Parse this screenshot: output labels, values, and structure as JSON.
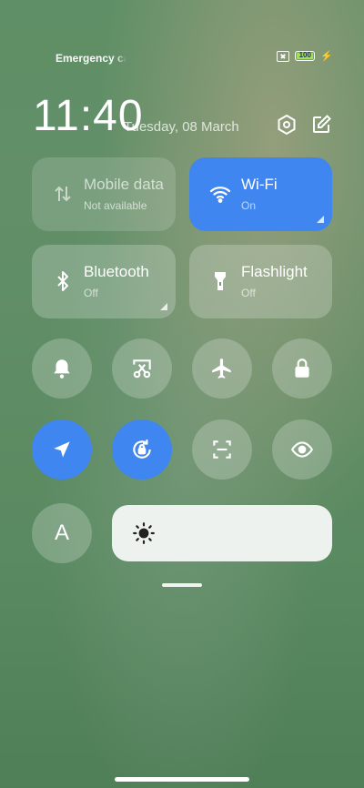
{
  "status_bar": {
    "carrier": "Emergency calls only",
    "battery": "100",
    "icons": [
      "no-sim-icon",
      "battery-icon",
      "charging-bolt-icon"
    ]
  },
  "header": {
    "time": "11:40",
    "date": "Tuesday, 08 March",
    "icons": [
      "settings-icon",
      "edit-icon"
    ]
  },
  "tiles": [
    {
      "title": "Mobile data",
      "subtitle": "Not available",
      "state": "unavailable",
      "icon": "mobile-data-icon"
    },
    {
      "title": "Wi-Fi",
      "subtitle": "On",
      "state": "on",
      "icon": "wifi-icon"
    },
    {
      "title": "Bluetooth",
      "subtitle": "Off",
      "state": "off",
      "icon": "bluetooth-icon"
    },
    {
      "title": "Flashlight",
      "subtitle": "Off",
      "state": "off",
      "icon": "flashlight-icon"
    }
  ],
  "toggles": [
    {
      "name": "bell-icon",
      "state": "off"
    },
    {
      "name": "screenshot-icon",
      "state": "off"
    },
    {
      "name": "airplane-icon",
      "state": "off"
    },
    {
      "name": "lock-icon",
      "state": "off"
    },
    {
      "name": "location-icon",
      "state": "on"
    },
    {
      "name": "rotation-lock-icon",
      "state": "on"
    },
    {
      "name": "scan-icon",
      "state": "off"
    },
    {
      "name": "eye-icon",
      "state": "off"
    }
  ],
  "bottom": {
    "font_label": "A",
    "brightness_icon": "sun-icon"
  },
  "colors": {
    "accent": "#3f86f0",
    "battery": "#9ee25b"
  }
}
